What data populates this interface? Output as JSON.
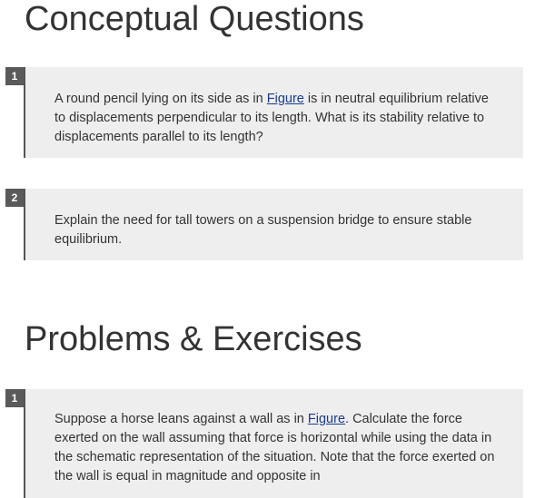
{
  "sections": {
    "conceptual": {
      "title": "Conceptual Questions",
      "items": [
        {
          "number": "1",
          "text_before": "A round pencil lying on its side as in ",
          "link": "Figure",
          "text_after": " is in neutral equilibrium relative to displacements perpendicular to its length. What is its stability relative to displacements parallel to its length?"
        },
        {
          "number": "2",
          "text": "Explain the need for tall towers on a suspension bridge to ensure stable equilibrium."
        }
      ]
    },
    "problems": {
      "title": "Problems & Exercises",
      "items": [
        {
          "number": "1",
          "text_before": "Suppose a horse leans against a wall as in ",
          "link": "Figure",
          "text_after": ". Calculate the force exerted on the wall assuming that force is horizontal while using the data in the schematic representation of the situation. Note that the force exerted on the wall is equal in magnitude and opposite in"
        }
      ]
    }
  }
}
